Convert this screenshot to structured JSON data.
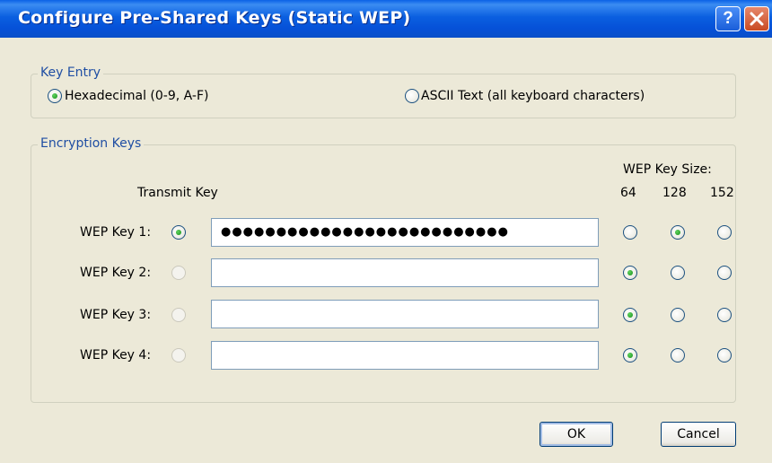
{
  "window": {
    "title": "Configure Pre-Shared Keys (Static WEP)",
    "help_glyph": "?",
    "close_glyph": "✕"
  },
  "key_entry": {
    "legend": "Key Entry",
    "options": [
      {
        "label": "Hexadecimal (0-9, A-F)",
        "checked": true
      },
      {
        "label": "ASCII Text (all keyboard characters)",
        "checked": false
      }
    ]
  },
  "encryption_keys": {
    "legend": "Encryption Keys",
    "transmit_key_header": "Transmit Key",
    "key_size_header": "WEP Key Size:",
    "size_labels": [
      "64",
      "128",
      "152"
    ],
    "keys": [
      {
        "label": "WEP Key 1:",
        "value": "●●●●●●●●●●●●●●●●●●●●●●●●●●",
        "transmit": true,
        "size": "128"
      },
      {
        "label": "WEP Key 2:",
        "value": "",
        "transmit": false,
        "size": "64"
      },
      {
        "label": "WEP Key 3:",
        "value": "",
        "transmit": false,
        "size": "64"
      },
      {
        "label": "WEP Key 4:",
        "value": "",
        "transmit": false,
        "size": "64"
      }
    ]
  },
  "buttons": {
    "ok": "OK",
    "cancel": "Cancel"
  },
  "colors": {
    "titlebar": "#0a5fe0",
    "legend_text": "#1f4ea3",
    "radio_dot": "#178d17"
  }
}
